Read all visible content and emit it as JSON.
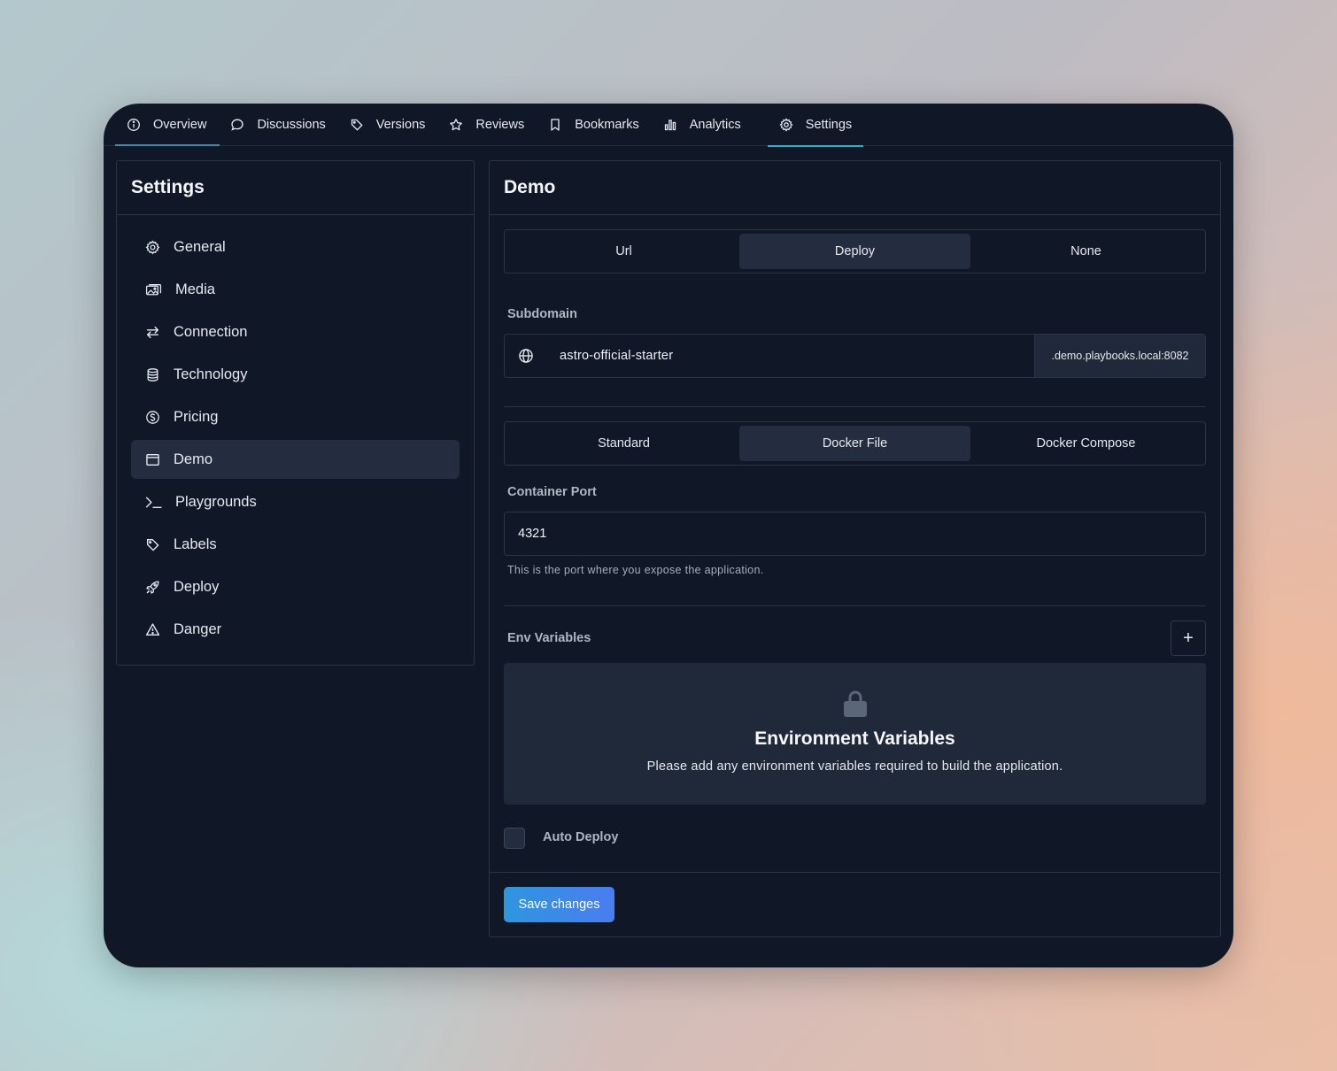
{
  "tabs": [
    {
      "label": "Overview",
      "icon": "info-icon"
    },
    {
      "label": "Discussions",
      "icon": "chat-icon"
    },
    {
      "label": "Versions",
      "icon": "tag-icon"
    },
    {
      "label": "Reviews",
      "icon": "star-icon"
    },
    {
      "label": "Bookmarks",
      "icon": "bookmark-icon"
    },
    {
      "label": "Analytics",
      "icon": "bar-chart-icon"
    },
    {
      "label": "Settings",
      "icon": "gear-icon"
    }
  ],
  "sidebar": {
    "title": "Settings",
    "items": [
      {
        "label": "General",
        "icon": "gear-icon"
      },
      {
        "label": "Media",
        "icon": "images-icon"
      },
      {
        "label": "Connection",
        "icon": "arrows-swap-icon"
      },
      {
        "label": "Technology",
        "icon": "database-icon"
      },
      {
        "label": "Pricing",
        "icon": "dollar-circle-icon"
      },
      {
        "label": "Demo",
        "icon": "browser-window-icon"
      },
      {
        "label": "Playgrounds",
        "icon": "terminal-icon"
      },
      {
        "label": "Labels",
        "icon": "tag-icon"
      },
      {
        "label": "Deploy",
        "icon": "rocket-icon"
      },
      {
        "label": "Danger",
        "icon": "warning-triangle-icon"
      }
    ],
    "active": "Demo"
  },
  "main": {
    "title": "Demo",
    "mode_tabs": [
      "Url",
      "Deploy",
      "None"
    ],
    "mode_active": "Deploy",
    "subdomain": {
      "label": "Subdomain",
      "value": "astro-official-starter",
      "suffix": ".demo.playbooks.local:8082"
    },
    "build_tabs": [
      "Standard",
      "Docker File",
      "Docker Compose"
    ],
    "build_active": "Docker File",
    "container_port": {
      "label": "Container Port",
      "value": "4321",
      "hint": "This is the port where you expose the application."
    },
    "env": {
      "label": "Env Variables",
      "add_label": "+",
      "empty_title": "Environment Variables",
      "empty_desc": "Please add any environment variables required to build the application."
    },
    "auto_deploy": {
      "label": "Auto Deploy",
      "checked": false
    },
    "save_label": "Save changes"
  },
  "colors": {
    "window_bg": "#101828",
    "border": "#2a3446",
    "active_bg": "#232d3f",
    "tab_underline": "#38a8c9",
    "button_gradient_start": "#2f96de",
    "button_gradient_end": "#4a7df0"
  }
}
